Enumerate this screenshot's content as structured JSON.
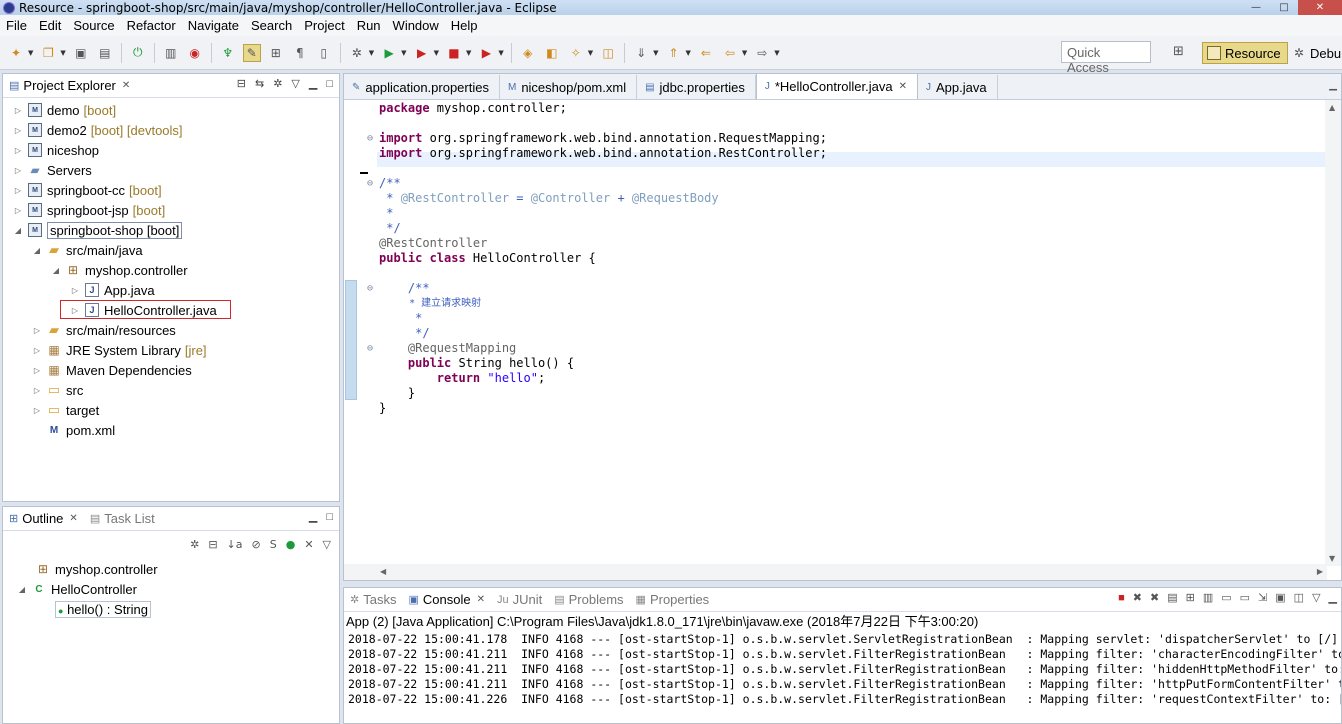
{
  "window": {
    "title": "Resource - springboot-shop/src/main/java/myshop/controller/HelloController.java - Eclipse",
    "minimize": "—",
    "maximize": "□",
    "close": "✕"
  },
  "menu": [
    "File",
    "Edit",
    "Source",
    "Refactor",
    "Navigate",
    "Search",
    "Project",
    "Run",
    "Window",
    "Help"
  ],
  "toolbar": {
    "quick_access": "Quick Access",
    "perspectives": [
      "Resource",
      "Debu"
    ]
  },
  "explorer": {
    "tab": "Project Explorer",
    "items": [
      {
        "label": "demo",
        "tag": "[boot]"
      },
      {
        "label": "demo2",
        "tag": "[boot] [devtools]"
      },
      {
        "label": "niceshop",
        "tag": ""
      },
      {
        "label": "Servers",
        "tag": ""
      },
      {
        "label": "springboot-cc",
        "tag": "[boot]"
      },
      {
        "label": "springboot-jsp",
        "tag": "[boot]"
      },
      {
        "label": "springboot-shop [boot]",
        "tag": ""
      },
      {
        "label": "src/main/java",
        "tag": ""
      },
      {
        "label": "myshop.controller",
        "tag": ""
      },
      {
        "label": "App.java",
        "tag": ""
      },
      {
        "label": "HelloController.java",
        "tag": ""
      },
      {
        "label": "src/main/resources",
        "tag": ""
      },
      {
        "label": "JRE System Library",
        "tag": "[jre]"
      },
      {
        "label": "Maven Dependencies",
        "tag": ""
      },
      {
        "label": "src",
        "tag": ""
      },
      {
        "label": "target",
        "tag": ""
      },
      {
        "label": "pom.xml",
        "tag": ""
      }
    ]
  },
  "outline": {
    "tabs": [
      "Outline",
      "Task List"
    ],
    "items": [
      "myshop.controller",
      "HelloController",
      "hello() : String"
    ]
  },
  "editor": {
    "tabs": [
      "application.properties",
      "niceshop/pom.xml",
      "jdbc.properties",
      "*HelloController.java",
      "App.java"
    ],
    "code": {
      "l1_kw": "package",
      "l1_rest": " myshop.controller;",
      "l3_kw": "import",
      "l3_rest": " org.springframework.web.bind.annotation.RequestMapping;",
      "l4_kw": "import",
      "l4_rest": " org.springframework.web.bind.annotation.RestController;",
      "l6": "/**",
      "l7_star": " * ",
      "l7_a": "@RestController",
      "l7_eq": " = ",
      "l7_b": "@Controller",
      "l7_plus": " + ",
      "l7_c": "@RequestBody",
      "l8": " *",
      "l9": " */",
      "l10": "@RestController",
      "l11_kw": "public class",
      "l11_rest": " HelloController {",
      "l13": "    /**",
      "l14": "     * 建立请求映射",
      "l15": "     *",
      "l16": "     */",
      "l17": "    @RequestMapping",
      "l18_indent": "    ",
      "l18_kw": "public",
      "l18_rest": " String hello() {",
      "l19_indent": "        ",
      "l19_kw": "return",
      "l19_sp": " ",
      "l19_str": "\"hello\"",
      "l19_end": ";",
      "l20": "    }",
      "l21": "}"
    }
  },
  "console": {
    "tabs": [
      "Tasks",
      "Console",
      "JUnit",
      "Problems",
      "Properties"
    ],
    "description": "App (2) [Java Application] C:\\Program Files\\Java\\jdk1.8.0_171\\jre\\bin\\javaw.exe (2018年7月22日 下午3:00:20)",
    "lines": [
      "2018-07-22 15:00:41.178  INFO 4168 --- [ost-startStop-1] o.s.b.w.servlet.ServletRegistrationBean  : Mapping servlet: 'dispatcherServlet' to [/]",
      "2018-07-22 15:00:41.211  INFO 4168 --- [ost-startStop-1] o.s.b.w.servlet.FilterRegistrationBean   : Mapping filter: 'characterEncodingFilter' to: [/*]",
      "2018-07-22 15:00:41.211  INFO 4168 --- [ost-startStop-1] o.s.b.w.servlet.FilterRegistrationBean   : Mapping filter: 'hiddenHttpMethodFilter' to: [/*]",
      "2018-07-22 15:00:41.211  INFO 4168 --- [ost-startStop-1] o.s.b.w.servlet.FilterRegistrationBean   : Mapping filter: 'httpPutFormContentFilter' to: [/*]",
      "2018-07-22 15:00:41.226  INFO 4168 --- [ost-startStop-1] o.s.b.w.servlet.FilterRegistrationBean   : Mapping filter: 'requestContextFilter' to: [/*]"
    ]
  }
}
